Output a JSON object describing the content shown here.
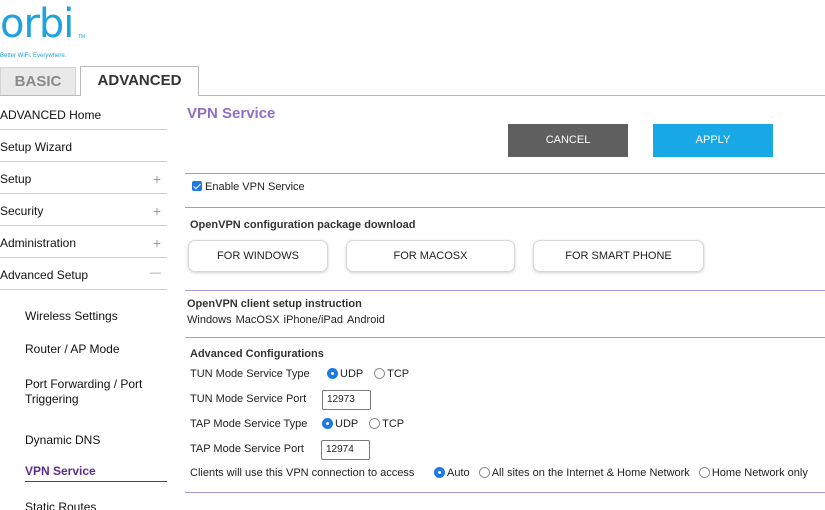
{
  "brand": {
    "logo_text": "orbi",
    "tm": "TM",
    "tagline": "Better WiFi. Everywhere.",
    "accent": "#1fa3dc"
  },
  "tabs": {
    "basic": "BASIC",
    "advanced": "ADVANCED",
    "active": "ADVANCED"
  },
  "sidebar": {
    "items": [
      {
        "label": "ADVANCED Home",
        "sign": ""
      },
      {
        "label": "Setup Wizard",
        "sign": ""
      },
      {
        "label": "Setup",
        "sign": "+"
      },
      {
        "label": "Security",
        "sign": "+"
      },
      {
        "label": "Administration",
        "sign": "+"
      },
      {
        "label": "Advanced Setup",
        "sign": "—"
      }
    ],
    "subitems": [
      "Wireless Settings",
      "Router / AP Mode",
      "Port Forwarding / Port Triggering",
      "Dynamic DNS",
      "VPN Service",
      "Static Routes"
    ],
    "active_subitem": "VPN Service"
  },
  "page": {
    "title": "VPN Service",
    "cancel_label": "CANCEL",
    "apply_label": "APPLY",
    "enable_label": "Enable VPN Service",
    "enable_checked": true,
    "download_heading": "OpenVPN configuration package download",
    "download_buttons": [
      "FOR WINDOWS",
      "FOR MACOSX",
      "FOR SMART PHONE"
    ],
    "client_heading": "OpenVPN client setup instruction",
    "client_links": [
      "Windows",
      "MacOSX",
      "iPhone/iPad",
      "Android"
    ],
    "advanced_heading": "Advanced Configurations",
    "tun_type_label": "TUN Mode Service Type",
    "tun_port_label": "TUN Mode Service Port",
    "tun_port_value": "12973",
    "tap_type_label": "TAP Mode Service Type",
    "tap_port_label": "TAP Mode Service Port",
    "tap_port_value": "12974",
    "opt_udp": "UDP",
    "opt_tcp": "TCP",
    "tun_type_selected": "UDP",
    "tap_type_selected": "UDP",
    "access_label": "Clients will use this VPN connection to access",
    "access_options": [
      "Auto",
      "All sites on the Internet & Home Network",
      "Home Network only"
    ],
    "access_selected": "Auto"
  },
  "colors": {
    "title": "#8f6fc4",
    "cancel_bg": "#5f5f5f",
    "apply_bg": "#19a8e6",
    "divider": "#a79ad6",
    "active_nav": "#5b2d8c",
    "radio_on": "#1f79e4"
  }
}
